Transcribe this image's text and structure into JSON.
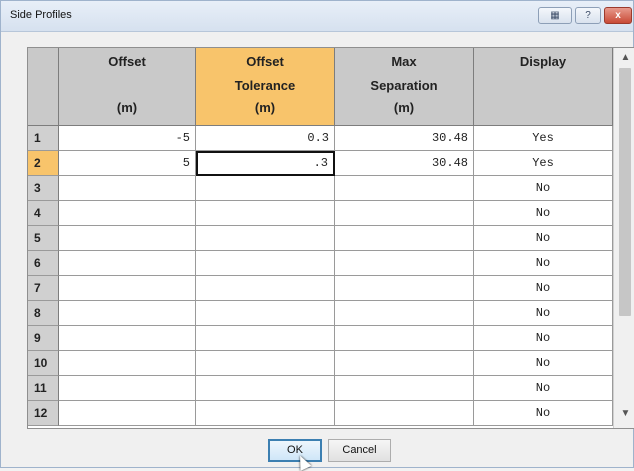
{
  "window": {
    "title": "Side Profiles",
    "help_label": "?",
    "close_label": "x"
  },
  "grid": {
    "columns": [
      {
        "line1": "Offset",
        "line2": "",
        "unit": "(m)"
      },
      {
        "line1": "Offset",
        "line2": "Tolerance",
        "unit": "(m)"
      },
      {
        "line1": "Max",
        "line2": "Separation",
        "unit": "(m)"
      },
      {
        "line1": "Display",
        "line2": "",
        "unit": ""
      }
    ],
    "selected_column": 1,
    "selected_row": 1,
    "rows": [
      {
        "n": "1",
        "offset": "-5",
        "tolerance": "0.3",
        "separation": "30.48",
        "display": "Yes"
      },
      {
        "n": "2",
        "offset": "5",
        "tolerance": ".3",
        "separation": "30.48",
        "display": "Yes"
      },
      {
        "n": "3",
        "offset": "",
        "tolerance": "",
        "separation": "",
        "display": "No"
      },
      {
        "n": "4",
        "offset": "",
        "tolerance": "",
        "separation": "",
        "display": "No"
      },
      {
        "n": "5",
        "offset": "",
        "tolerance": "",
        "separation": "",
        "display": "No"
      },
      {
        "n": "6",
        "offset": "",
        "tolerance": "",
        "separation": "",
        "display": "No"
      },
      {
        "n": "7",
        "offset": "",
        "tolerance": "",
        "separation": "",
        "display": "No"
      },
      {
        "n": "8",
        "offset": "",
        "tolerance": "",
        "separation": "",
        "display": "No"
      },
      {
        "n": "9",
        "offset": "",
        "tolerance": "",
        "separation": "",
        "display": "No"
      },
      {
        "n": "10",
        "offset": "",
        "tolerance": "",
        "separation": "",
        "display": "No"
      },
      {
        "n": "11",
        "offset": "",
        "tolerance": "",
        "separation": "",
        "display": "No"
      },
      {
        "n": "12",
        "offset": "",
        "tolerance": "",
        "separation": "",
        "display": "No"
      }
    ]
  },
  "buttons": {
    "ok": "OK",
    "cancel": "Cancel"
  }
}
